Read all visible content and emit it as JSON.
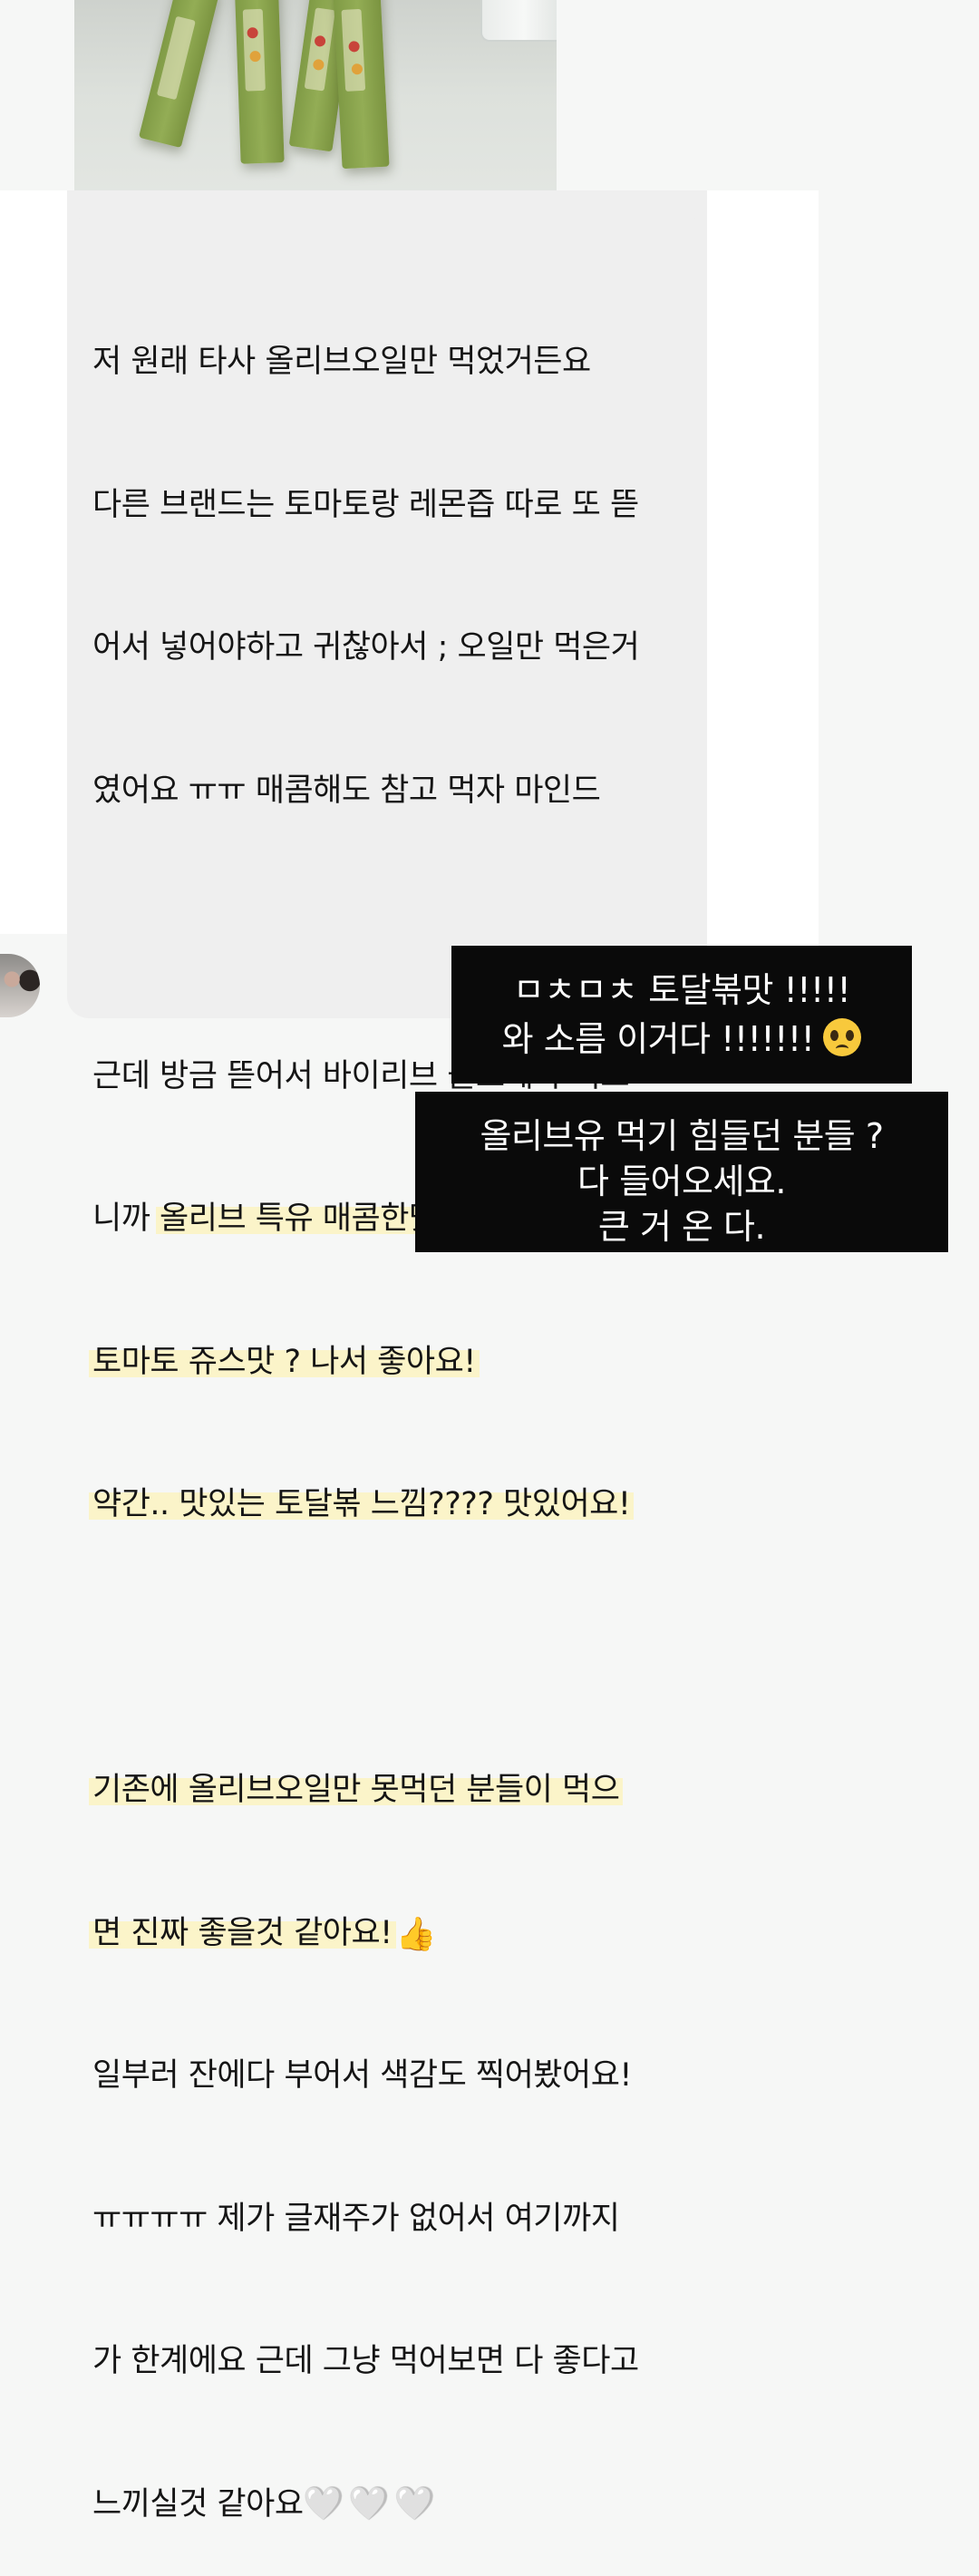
{
  "message": {
    "lines": [
      "저 원래 타사 올리브오일만 먹었거든요",
      "다른 브랜드는 토마토랑 레몬즙 따로 또 뜯",
      "어서 넣어야하고 귀찮아서 ; 오일만 먹은거",
      "였어요 ㅠㅠ 매콤해도 참고 먹자 마인드",
      "",
      "근데 방금 뜯어서 바이리브 올토레샤 먹으",
      "니까",
      "올리브 특유 매콤한맛은 안느껴지고",
      "토마토 쥬스맛 ? 나서 좋아요!",
      "약간.. 맛있는 토달볶 느낌???? 맛있어요!",
      "",
      "기존에 올리브오일만 못먹던 분들이 먹으",
      "면 진짜 좋을것 같아요!",
      "일부러 잔에다 부어서 색감도 찍어봤어요!",
      "ㅠㅠㅠㅠ 제가 글재주가 없어서 여기까지",
      "가 한계에요 근데 그냥 먹어보면 다 좋다고",
      "느끼실것 같아요"
    ],
    "thumbs_emoji": "👍",
    "hearts": [
      "🤍",
      "🤍",
      "🤍"
    ]
  },
  "caption_1": {
    "line1": "ㅁㅊㅁㅊ 토달볶맛 !!!!!",
    "line2": "와 소름 이거다 !!!!!!!",
    "emoji": "pleading-face"
  },
  "caption_2": {
    "line1": "올리브유 먹기 힘들던 분들 ?",
    "line2": "다 들어오세요.",
    "line3": "큰 거 온 다."
  },
  "colors": {
    "bubble": "#efefef",
    "highlight": "#fbf4c9",
    "caption_bg": "#0a0a0a",
    "stick_green": "#8aa44c"
  }
}
